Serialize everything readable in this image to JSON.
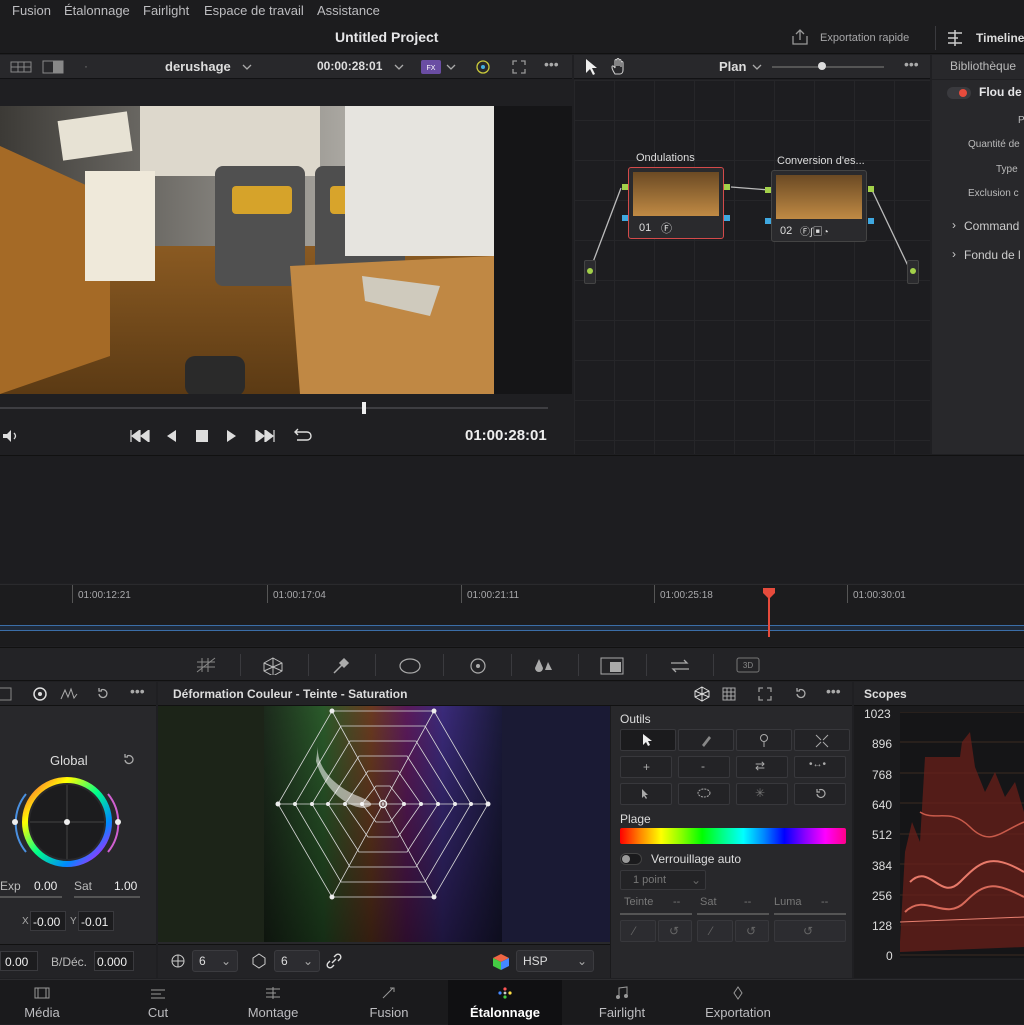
{
  "menu": {
    "items": [
      "Fusion",
      "Étalonnage",
      "Fairlight",
      "Espace de travail",
      "Assistance"
    ]
  },
  "title": "Untitled Project",
  "header": {
    "quick_export": "Exportation rapide",
    "timeline": "Timeline"
  },
  "viewer": {
    "clip_name": "derushage",
    "timecode_top": "00:00:28:01",
    "timecode_bottom": "01:00:28:01",
    "playhead_fraction": 0.66
  },
  "node_editor": {
    "mode": "Plan",
    "nodes": [
      {
        "title": "Ondulations",
        "number": "01"
      },
      {
        "title": "Conversion d'es...",
        "number": "02"
      }
    ]
  },
  "library": {
    "title": "Bibliothèque",
    "item_title": "Flou de",
    "fields": [
      "P",
      "Quantité de",
      "Type",
      "Exclusion c"
    ],
    "sections": [
      "Command",
      "Fondu de l"
    ]
  },
  "timeline": {
    "ticks": [
      "01:00:12:21",
      "01:00:17:04",
      "01:00:21:11",
      "01:00:25:18",
      "01:00:30:01"
    ]
  },
  "wheels": {
    "title": "Global",
    "exp_label": "Exp",
    "exp_value": "0.00",
    "sat_label": "Sat",
    "sat_value": "1.00",
    "x_label": "X",
    "x_value": "-0.00",
    "y_label": "Y",
    "y_value": "-0.01",
    "bottom_value": "0.00",
    "bdec_label": "B/Déc.",
    "bdec_value": "0.000"
  },
  "warper": {
    "title": "Déformation Couleur - Teinte - Saturation",
    "res1": "6",
    "res2": "6",
    "color_space": "HSP"
  },
  "tools": {
    "title": "Outils",
    "range_label": "Plage",
    "autolock_label": "Verrouillage auto",
    "points": "1 point",
    "teinte": "Teinte",
    "sat": "Sat",
    "luma": "Luma",
    "dash": "--"
  },
  "scopes": {
    "title": "Scopes",
    "scale": [
      "1023",
      "896",
      "768",
      "640",
      "512",
      "384",
      "256",
      "128",
      "0"
    ]
  },
  "pages": [
    {
      "label": "Média",
      "icon": "media-icon"
    },
    {
      "label": "Cut",
      "icon": "cut-icon"
    },
    {
      "label": "Montage",
      "icon": "edit-icon"
    },
    {
      "label": "Fusion",
      "icon": "fusion-icon"
    },
    {
      "label": "Étalonnage",
      "icon": "color-icon"
    },
    {
      "label": "Fairlight",
      "icon": "fairlight-icon"
    },
    {
      "label": "Exportation",
      "icon": "deliver-icon"
    }
  ],
  "colors": {
    "accent": "#e64b3c",
    "active_page": "#101012",
    "timeline_track": "#3b6ea8"
  }
}
